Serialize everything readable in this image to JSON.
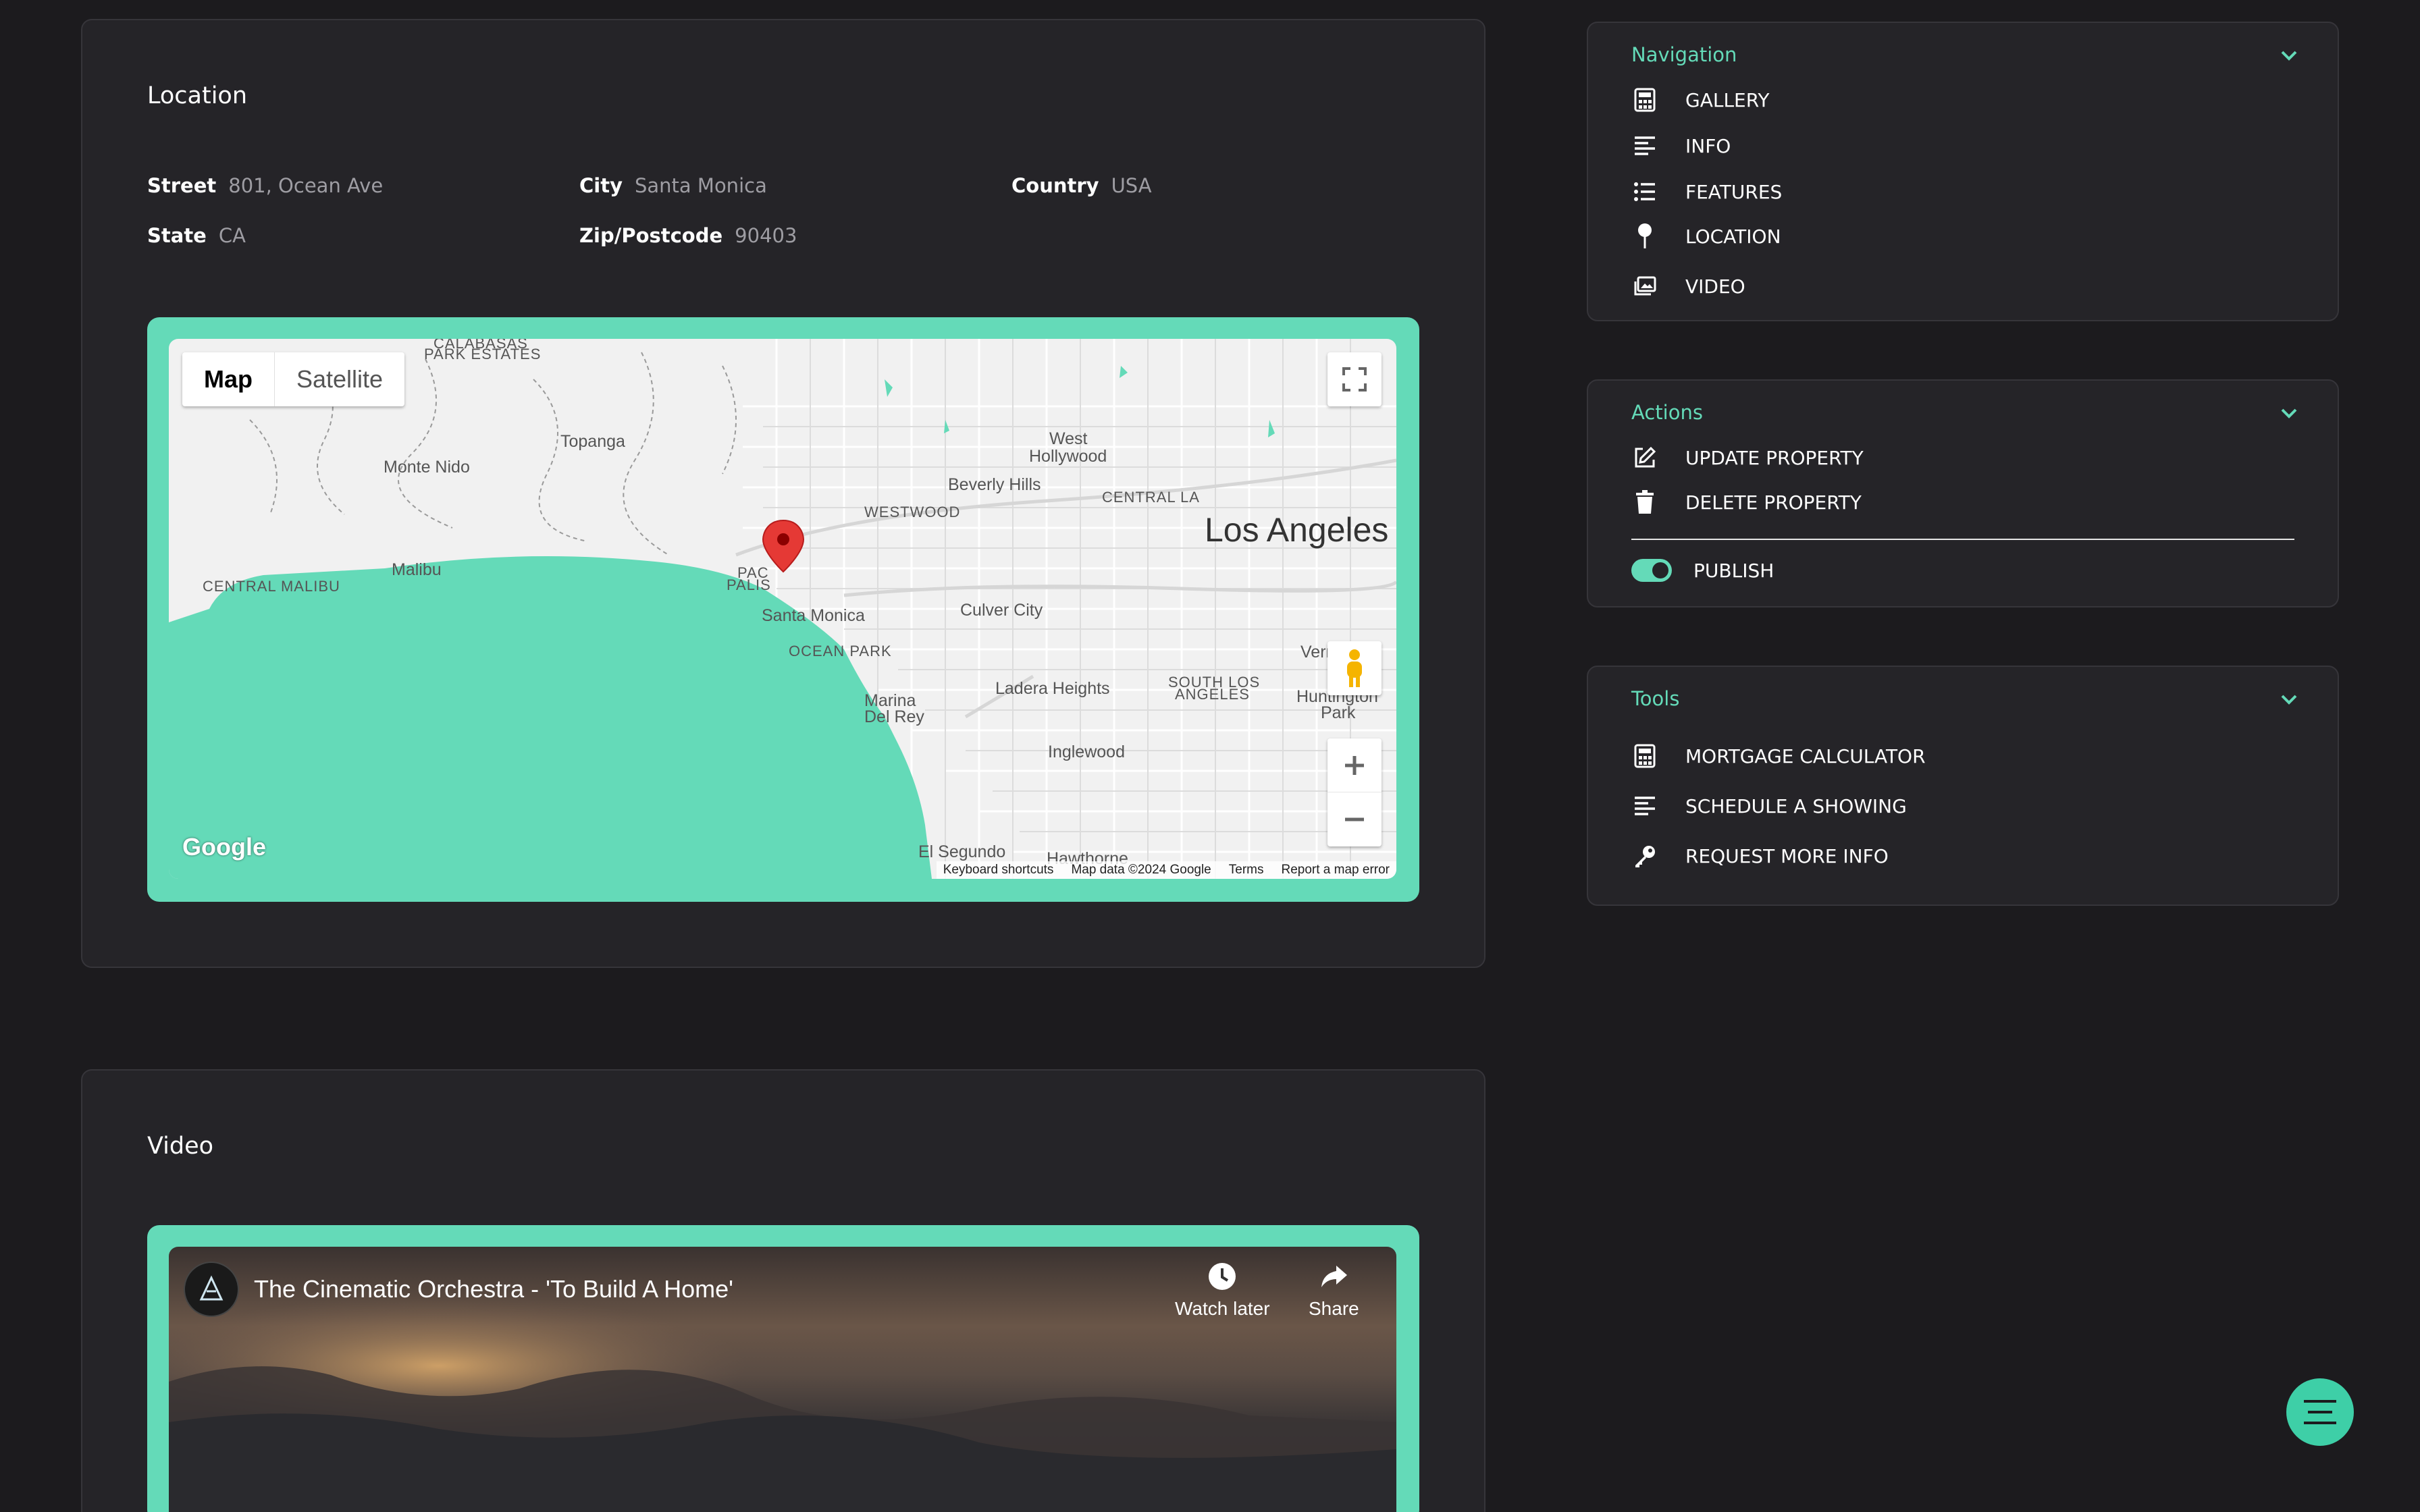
{
  "location": {
    "title": "Location",
    "fields": [
      {
        "label": "Street",
        "value": "801, Ocean Ave"
      },
      {
        "label": "City",
        "value": "Santa Monica"
      },
      {
        "label": "Country",
        "value": "USA"
      },
      {
        "label": "State",
        "value": "CA"
      },
      {
        "label": "Zip/Postcode",
        "value": "90403"
      }
    ],
    "map": {
      "type_buttons": [
        "Map",
        "Satellite"
      ],
      "active_type": "Map",
      "labels": {
        "calabasas": "CALABASAS",
        "park_estates": "PARK ESTATES",
        "topanga": "Topanga",
        "monte_nido": "Monte Nido",
        "west_hollywood_1": "West",
        "west_hollywood_2": "Hollywood",
        "beverly_hills": "Beverly Hills",
        "central_la": "CENTRAL LA",
        "westwood": "WESTWOOD",
        "los_angeles": "Los Angeles",
        "malibu": "Malibu",
        "central_malibu": "CENTRAL MALIBU",
        "pacific_1": "PAC",
        "pacific_2": "PALIS",
        "santa_monica": "Santa Monica",
        "culver_city": "Culver City",
        "ocean_park": "OCEAN PARK",
        "ladera_heights": "Ladera Heights",
        "south_la_1": "SOUTH LOS",
        "south_la_2": "ANGELES",
        "marina_1": "Marina",
        "marina_2": "Del Rey",
        "huntington_1": "Huntington",
        "huntington_2": "Park",
        "inglewood": "Inglewood",
        "el_segundo": "El Segundo",
        "hawthorne": "Hawthorne",
        "vern": "Vern"
      },
      "google_logo": "Google",
      "footer": [
        "Keyboard shortcuts",
        "Map data ©2024 Google",
        "Terms",
        "Report a map error"
      ]
    }
  },
  "video": {
    "title": "Video",
    "video_title": "The Cinematic Orchestra - 'To Build A Home'",
    "watch_later": "Watch later",
    "share": "Share"
  },
  "navigation": {
    "title": "Navigation",
    "items": [
      {
        "label": "GALLERY",
        "icon": "calculator-icon"
      },
      {
        "label": "INFO",
        "icon": "align-left-icon"
      },
      {
        "label": "FEATURES",
        "icon": "list-icon"
      },
      {
        "label": "LOCATION",
        "icon": "pin-icon"
      },
      {
        "label": "VIDEO",
        "icon": "images-icon"
      }
    ]
  },
  "actions": {
    "title": "Actions",
    "items": [
      {
        "label": "UPDATE PROPERTY",
        "icon": "edit-icon"
      },
      {
        "label": "DELETE PROPERTY",
        "icon": "trash-icon"
      }
    ],
    "publish_label": "PUBLISH",
    "publish_on": true
  },
  "tools": {
    "title": "Tools",
    "items": [
      {
        "label": "MORTGAGE CALCULATOR",
        "icon": "calculator-icon"
      },
      {
        "label": "SCHEDULE A SHOWING",
        "icon": "align-left-icon"
      },
      {
        "label": "REQUEST MORE INFO",
        "icon": "key-icon"
      }
    ]
  },
  "colors": {
    "accent": "#64dab8",
    "background": "#1c1b1e",
    "card": "#252428"
  }
}
